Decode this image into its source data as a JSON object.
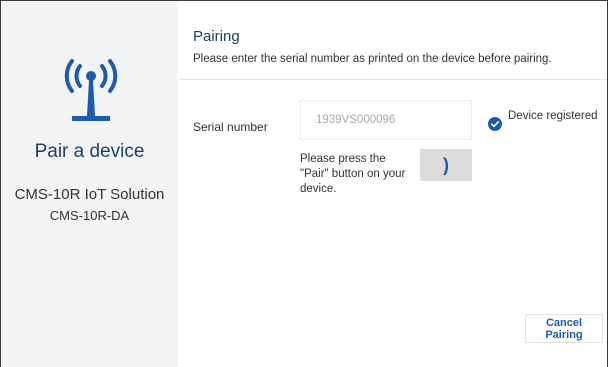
{
  "left": {
    "icon": "antenna-icon",
    "title": "Pair a device",
    "product_name": "CMS-10R IoT Solution",
    "product_model": "CMS-10R-DA"
  },
  "main": {
    "title": "Pairing",
    "description": "Please enter the serial number as printed on the device before pairing.",
    "serial_label": "Serial number",
    "serial_value": "1939VS000096",
    "status_icon": "check-circle-icon",
    "status_label": "Device registered",
    "instruction": "Please press the \"Pair\" button on your device.",
    "pair_button_glyph": ")",
    "cancel_label": "Cancel Pairing"
  },
  "colors": {
    "accent": "#1d5bb0",
    "heading": "#1f3f6b",
    "panel_bg": "#f3f4f6"
  }
}
